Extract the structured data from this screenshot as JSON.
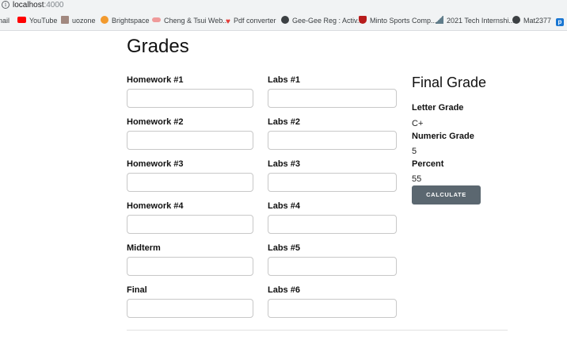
{
  "browser": {
    "url_host": "localhost",
    "url_port": ":4000",
    "bookmarks": [
      {
        "label": "nail",
        "icon": "gmail-icon",
        "color": "#d93025"
      },
      {
        "label": "YouTube",
        "icon": "youtube-icon",
        "color": "#ff0000"
      },
      {
        "label": "uozone",
        "icon": "building-icon",
        "color": "#8d6e63"
      },
      {
        "label": "Brightspace",
        "icon": "brightspace-icon",
        "color": "#f29a2e"
      },
      {
        "label": "Cheng & Tsui Web...",
        "icon": "cheng-tsui-icon",
        "color": "#e57373"
      },
      {
        "label": "Pdf converter",
        "icon": "heart-icon",
        "color": "#e53935"
      },
      {
        "label": "Gee-Gee Reg : Activ...",
        "icon": "globe-icon",
        "color": "#3c4043"
      },
      {
        "label": "Minto Sports Comp...",
        "icon": "shield-icon",
        "color": "#b71c1c"
      },
      {
        "label": "2021 Tech Internshi...",
        "icon": "chart-icon",
        "color": "#607d8b"
      },
      {
        "label": "Mat2377",
        "icon": "globe-icon",
        "color": "#3c4043"
      },
      {
        "label": "",
        "icon": "p-icon",
        "color": "#1976d2"
      }
    ]
  },
  "page": {
    "title": "Grades"
  },
  "fields": {
    "homework1": {
      "label": "Homework #1",
      "value": ""
    },
    "homework2": {
      "label": "Homework #2",
      "value": ""
    },
    "homework3": {
      "label": "Homework #3",
      "value": ""
    },
    "homework4": {
      "label": "Homework #4",
      "value": ""
    },
    "midterm": {
      "label": "Midterm",
      "value": ""
    },
    "final": {
      "label": "Final",
      "value": ""
    },
    "labs1": {
      "label": "Labs #1",
      "value": ""
    },
    "labs2": {
      "label": "Labs #2",
      "value": ""
    },
    "labs3": {
      "label": "Labs #3",
      "value": ""
    },
    "labs4": {
      "label": "Labs #4",
      "value": ""
    },
    "labs5": {
      "label": "Labs #5",
      "value": ""
    },
    "labs6": {
      "label": "Labs #6",
      "value": ""
    }
  },
  "result": {
    "title": "Final Grade",
    "letter_label": "Letter Grade",
    "letter_value": "C+",
    "numeric_label": "Numeric Grade",
    "numeric_value": "5",
    "percent_label": "Percent",
    "percent_value": "55",
    "calculate_label": "CALCULATE"
  }
}
